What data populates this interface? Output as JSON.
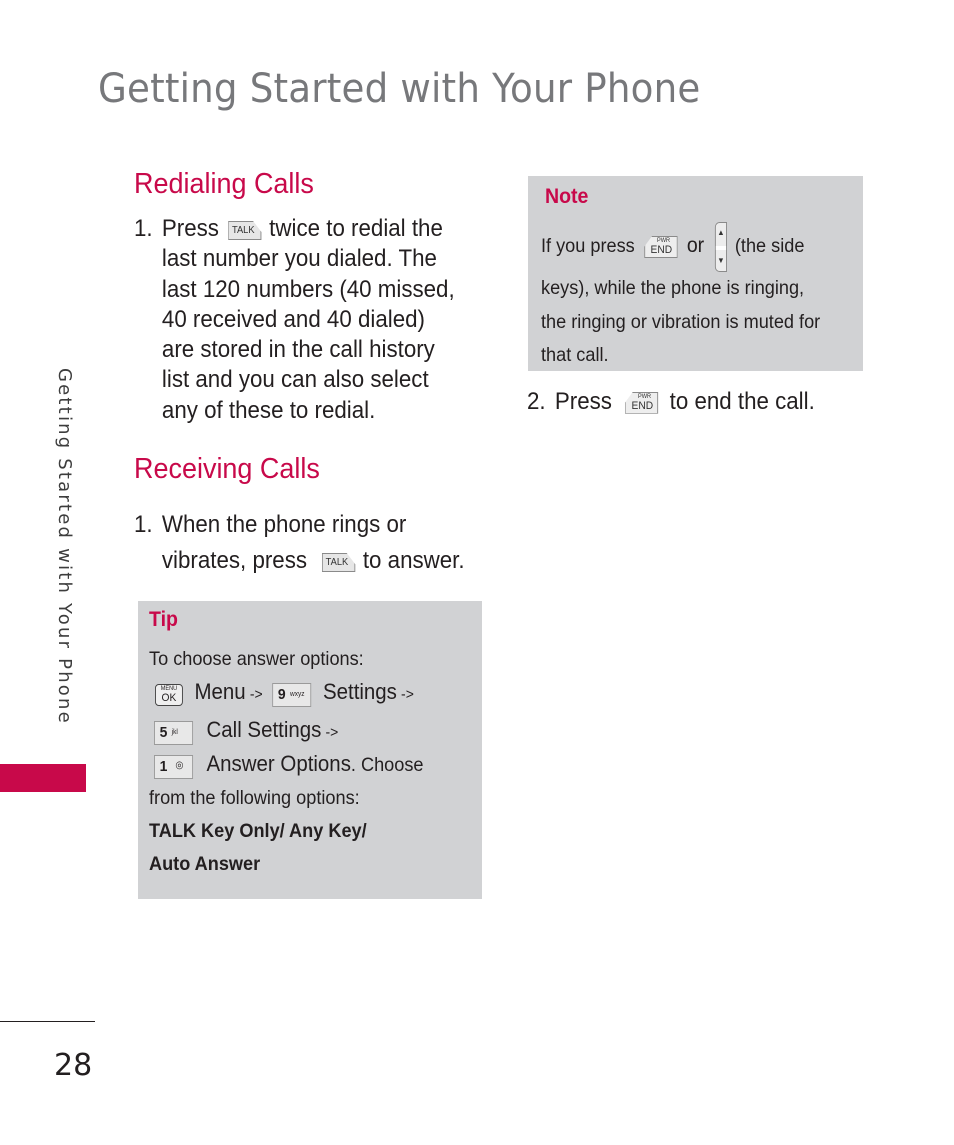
{
  "page": {
    "title": "Getting Started with Your Phone",
    "side_label": "Getting Started with Your Phone",
    "page_number": "28",
    "accent_color": "#c8094a",
    "box_color": "#d1d2d4"
  },
  "redialing": {
    "heading": "Redialing Calls",
    "step_number": "1.",
    "lines": [
      {
        "before": "Press",
        "key": "talk-key",
        "after": "twice to redial the"
      },
      {
        "text": "last number you dialed. The"
      },
      {
        "text": "last 120 numbers (40 missed,"
      },
      {
        "text": "40 received and 40 dialed)"
      },
      {
        "text": "are stored in the call history"
      },
      {
        "text": "list and you can also select"
      },
      {
        "text": "any of these to redial."
      }
    ]
  },
  "receiving": {
    "heading": "Receiving Calls",
    "step_number": "1.",
    "line1": "When the phone rings or",
    "line2_before": "vibrates, press",
    "line2_after": "to answer."
  },
  "keys": {
    "talk": "TALK",
    "pwr": "PWR",
    "end": "END",
    "menu_top": "MENU",
    "menu_ok": "OK",
    "key9_num": "9",
    "key9_letters": "wxyz",
    "key5_num": "5",
    "key5_letters": "jkl",
    "key1_num": "1",
    "key1_glyph": "◎",
    "side_up": "▲",
    "side_down": "▼"
  },
  "tip": {
    "label": "Tip",
    "intro": "To choose answer options:",
    "menu_label": "Menu",
    "settings_label": "Settings",
    "call_settings_label": "Call Settings",
    "answer_options_label": "Answer Options",
    "arrow": "->",
    "choose_text": ". Choose",
    "from_text": "from the following options:",
    "options_line1": "TALK Key Only/ Any Key/",
    "options_line2": "Auto Answer"
  },
  "note": {
    "label": "Note",
    "line1_before": "If you press",
    "line1_or": "or",
    "line1_after": "(the side",
    "line2": "keys), while the phone is ringing,",
    "line3": "the ringing or vibration is muted for",
    "line4": "that call."
  },
  "end_call": {
    "step_number": "2.",
    "before": "Press",
    "after": "to end the call."
  }
}
